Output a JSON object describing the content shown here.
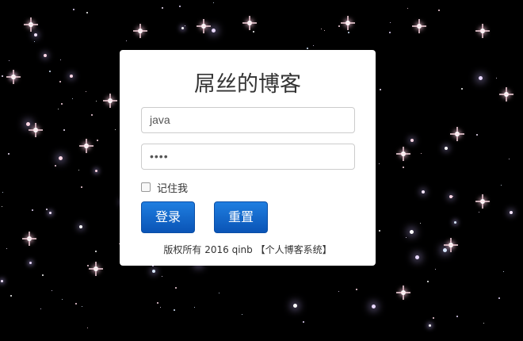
{
  "login": {
    "title": "屌丝的博客",
    "username_value": "java",
    "password_value": "••••",
    "remember_label": "记住我",
    "login_label": "登录",
    "reset_label": "重置",
    "footer_text": "版权所有 2016 qinb 【个人博客系统】"
  },
  "colors": {
    "background": "#000000",
    "button_accent": "#0a63c9"
  },
  "icons": {
    "remember_checkbox": "checkbox-icon"
  }
}
